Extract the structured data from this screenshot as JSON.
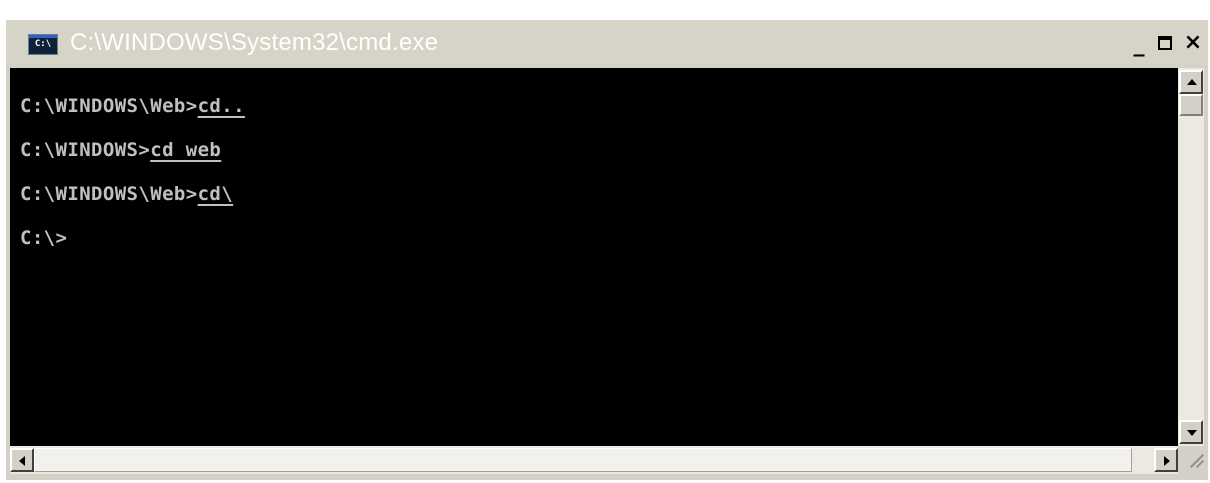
{
  "window": {
    "title": "C:\\WINDOWS\\System32\\cmd.exe",
    "icon_label": "C:\\",
    "controls": {
      "minimize": "_",
      "close": "×"
    }
  },
  "console": {
    "lines": [
      {
        "prompt": "C:\\WINDOWS\\Web>",
        "command": "cd.."
      },
      {
        "prompt": "C:\\WINDOWS>",
        "command": "cd web"
      },
      {
        "prompt": "C:\\WINDOWS\\Web>",
        "command": "cd\\"
      },
      {
        "prompt": "C:\\>",
        "command": ""
      }
    ]
  },
  "colors": {
    "console_bg": "#000000",
    "console_text": "#c0c0c0",
    "title_bg": "#d6d3c7",
    "title_text": "#ffffff"
  },
  "icons": {
    "app": "cmd-app-icon",
    "scroll_up": "arrow-up-icon",
    "scroll_down": "arrow-down-icon",
    "scroll_left": "arrow-left-icon",
    "scroll_right": "arrow-right-icon"
  }
}
